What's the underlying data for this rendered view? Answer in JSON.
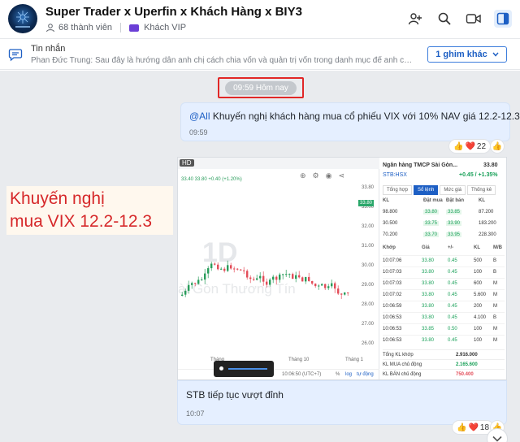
{
  "header": {
    "title": "Super Trader x Uperfin x Khách Hàng x BIY3",
    "members": "68 thành viên",
    "tag": "Khách VIP"
  },
  "pinned": {
    "title": "Tin nhắn",
    "text": "Phan Đức Trung: Sau đây là hướng dẫn anh chị cách chia vốn và quản trị vốn trong danh mục để anh chị quản l...",
    "button": "1 ghim khác"
  },
  "chat": {
    "date_label": "09:59 Hôm nay",
    "message1": {
      "mention": "@All",
      "text": " Khuyến nghị khách hàng mua cổ phiếu VIX với 10% NAV giá 12.2-12.3",
      "time": "09:59",
      "reaction_count": "22"
    },
    "overlay": {
      "line1": "Khuyến nghị",
      "line2": "mua VIX 12.2-12.3"
    },
    "chart_image": {
      "hd": "HD",
      "watermark_big": "1D",
      "watermark_small": "ài Gòn Thương Tín",
      "ohlc": "33.40 33.80 +0.40 (+1.20%)",
      "price_ticks": [
        "33.80",
        "33.00",
        "32.00",
        "31.00",
        "30.00",
        "29.00",
        "28.00",
        "27.00",
        "26.00"
      ],
      "x_ticks": [
        "Tháng",
        "Tháng 10",
        "Tháng 1"
      ],
      "bottom_time": "10:06:50 (UTC+7)",
      "bottom_pct": "%",
      "bottom_log": "log",
      "bottom_auto": "tự động",
      "stock_name": "Ngân hàng TMCP Sài Gòn...",
      "stock_price": "33.80",
      "stock_code": "STB:HSX",
      "stock_change": "+0.45 / +1.35%",
      "tabs": [
        "Tổng hợp",
        "Sổ lệnh",
        "Mức giá",
        "Thống kê"
      ],
      "orderbook_head": [
        "KL",
        "Đặt mua",
        "Đặt bán",
        "KL"
      ],
      "orderbook": [
        [
          "98.800",
          "33.80",
          "33.85",
          "87.200"
        ],
        [
          "30.500",
          "33.75",
          "33.90",
          "183.200"
        ],
        [
          "70.200",
          "33.70",
          "33.95",
          "228.300"
        ]
      ],
      "trades_head": [
        "Khớp",
        "Giá",
        "+/-",
        "KL",
        "M/B"
      ],
      "trades": [
        [
          "10:07:06",
          "33.80",
          "0.45",
          "500",
          "B"
        ],
        [
          "10:07:03",
          "33.80",
          "0.45",
          "100",
          "B"
        ],
        [
          "10:07:03",
          "33.80",
          "0.45",
          "600",
          "M"
        ],
        [
          "10:07:02",
          "33.80",
          "0.45",
          "5.600",
          "M"
        ],
        [
          "10:06:59",
          "33.80",
          "0.45",
          "200",
          "M"
        ],
        [
          "10:06:53",
          "33.80",
          "0.45",
          "4.100",
          "B"
        ],
        [
          "10:06:53",
          "33.85",
          "0.50",
          "100",
          "M"
        ],
        [
          "10:06:53",
          "33.80",
          "0.45",
          "100",
          "M"
        ]
      ],
      "summary": [
        [
          "Tổng KL khớp",
          "2.916.000"
        ],
        [
          "KL MUA chủ động",
          "2.165.600"
        ],
        [
          "KL BÁN chủ động",
          "750.400"
        ]
      ]
    },
    "message2": {
      "text": "STB tiếp tục vượt đỉnh",
      "time": "10:07",
      "reaction_count": "18"
    }
  },
  "colors": {
    "accent": "#1d5fc4",
    "highlight_box": "#e12727",
    "overlay_text": "#d6282a",
    "up": "#18a058",
    "down": "#e34d59"
  }
}
